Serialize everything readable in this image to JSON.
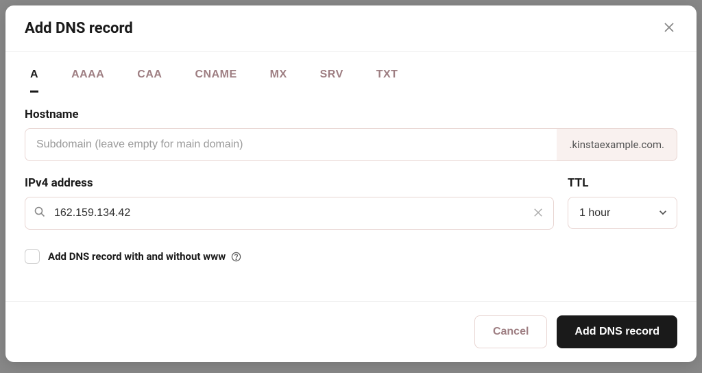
{
  "modal": {
    "title": "Add DNS record"
  },
  "tabs": [
    {
      "label": "A",
      "active": true
    },
    {
      "label": "AAAA",
      "active": false
    },
    {
      "label": "CAA",
      "active": false
    },
    {
      "label": "CNAME",
      "active": false
    },
    {
      "label": "MX",
      "active": false
    },
    {
      "label": "SRV",
      "active": false
    },
    {
      "label": "TXT",
      "active": false
    }
  ],
  "hostname": {
    "label": "Hostname",
    "placeholder": "Subdomain (leave empty for main domain)",
    "value": "",
    "suffix": ".kinstaexample.com."
  },
  "ipv4": {
    "label": "IPv4 address",
    "value": "162.159.134.42"
  },
  "ttl": {
    "label": "TTL",
    "selected": "1 hour"
  },
  "checkbox": {
    "label": "Add DNS record with and without www",
    "checked": false
  },
  "footer": {
    "cancel": "Cancel",
    "submit": "Add DNS record"
  }
}
